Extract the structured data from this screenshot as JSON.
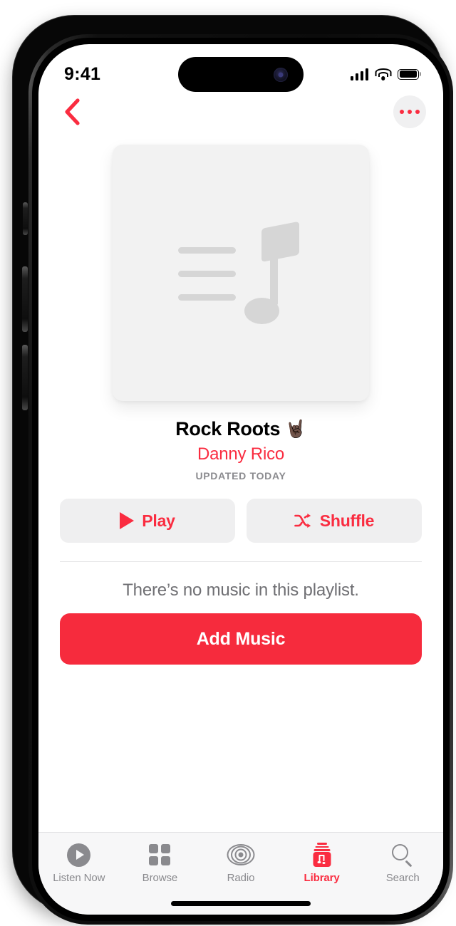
{
  "status_bar": {
    "time": "9:41",
    "signal_icon": "cellular-signal-icon",
    "wifi_icon": "wifi-icon",
    "battery_icon": "battery-icon"
  },
  "nav": {
    "back_icon": "chevron-left-icon",
    "more_icon": "ellipsis-icon"
  },
  "artwork": {
    "placeholder_icon": "playlist-music-note-icon",
    "background_color": "#f2f2f2"
  },
  "playlist": {
    "title": "Rock Roots",
    "title_emoji": "🤘🏿",
    "artist": "Danny Rico",
    "updated": "UPDATED TODAY"
  },
  "actions": {
    "play_label": "Play",
    "play_icon": "play-triangle-icon",
    "shuffle_label": "Shuffle",
    "shuffle_icon": "shuffle-arrows-icon"
  },
  "empty_state": {
    "message": "There’s no music in this playlist.",
    "add_music_label": "Add Music"
  },
  "tab_bar": {
    "tabs": [
      {
        "label": "Listen Now",
        "icon": "play-circle-icon",
        "active": false
      },
      {
        "label": "Browse",
        "icon": "grid-squares-icon",
        "active": false
      },
      {
        "label": "Radio",
        "icon": "radio-waves-icon",
        "active": false
      },
      {
        "label": "Library",
        "icon": "library-music-icon",
        "active": true
      },
      {
        "label": "Search",
        "icon": "search-icon",
        "active": false
      }
    ]
  },
  "colors": {
    "accent_red": "#fa2c40",
    "add_music_red": "#f62b3d",
    "secondary_gray": "#8a8a8e",
    "button_gray": "#efeff0"
  }
}
